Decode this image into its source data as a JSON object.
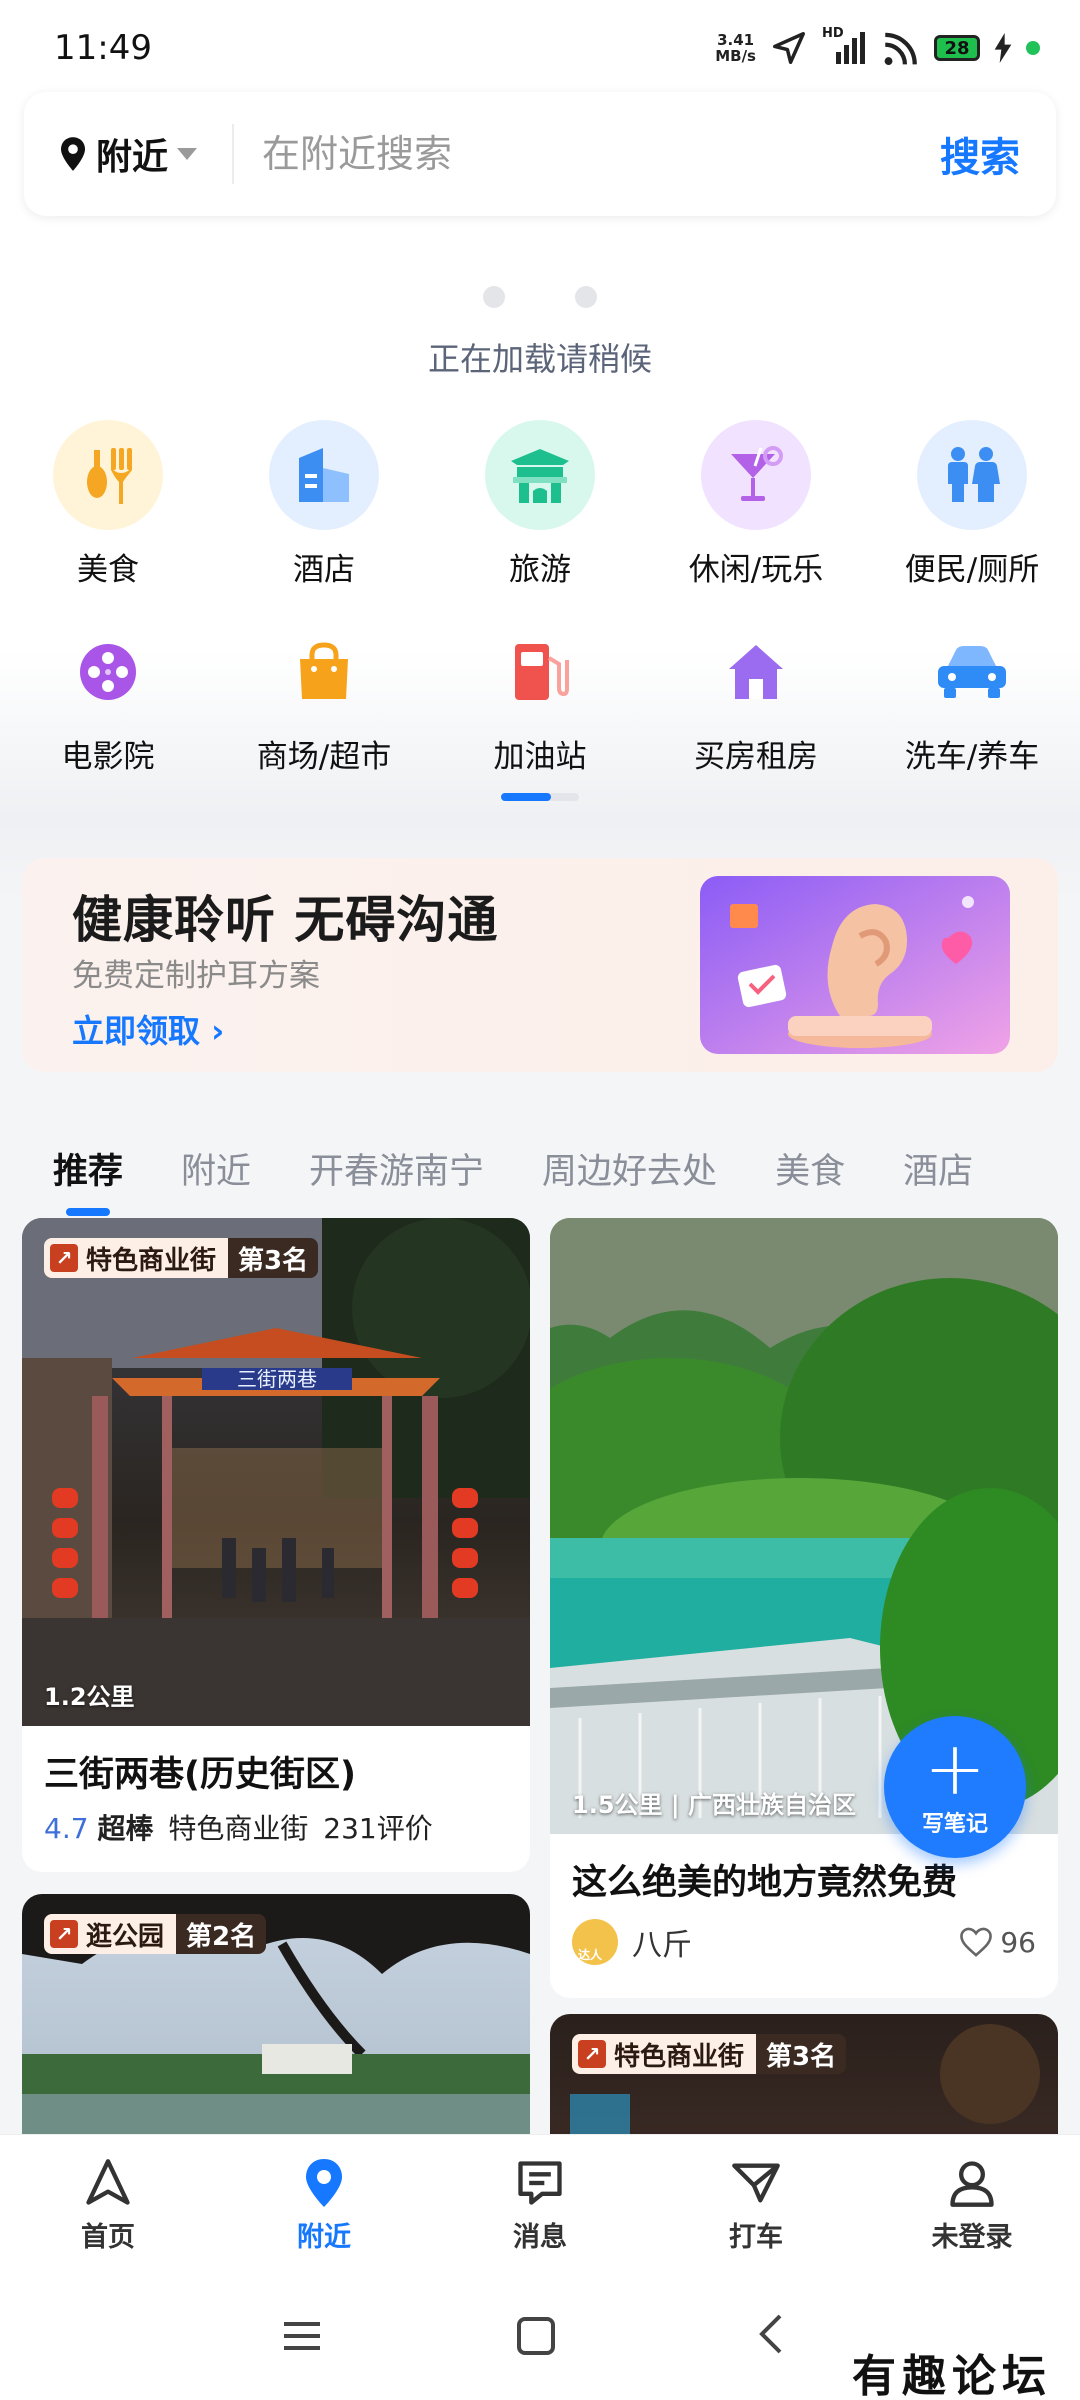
{
  "status_bar": {
    "time": "11:49",
    "net_speed_value": "3.41",
    "net_speed_unit": "MB/s",
    "network": "HD",
    "battery": "28"
  },
  "search": {
    "location_label": "附近",
    "placeholder": "在附近搜索",
    "button_label": "搜索"
  },
  "loading": {
    "text": "正在加载请稍候"
  },
  "categories": [
    {
      "label": "美食",
      "icon": "fork-spoon-icon",
      "color": "#f5a623"
    },
    {
      "label": "酒店",
      "icon": "hotel-building-icon",
      "color": "#3c8ef3"
    },
    {
      "label": "旅游",
      "icon": "pavilion-icon",
      "color": "#1dbf8e"
    },
    {
      "label": "休闲/玩乐",
      "icon": "cocktail-icon",
      "color": "#b361e6"
    },
    {
      "label": "便民/厕所",
      "icon": "restroom-icon",
      "color": "#3c8ef3"
    },
    {
      "label": "电影院",
      "icon": "film-reel-icon",
      "color": "#a855e8"
    },
    {
      "label": "商场/超市",
      "icon": "shopping-bag-icon",
      "color": "#f7a21b"
    },
    {
      "label": "加油站",
      "icon": "gas-pump-icon",
      "color": "#f0524d"
    },
    {
      "label": "买房租房",
      "icon": "house-icon",
      "color": "#9b6cf0"
    },
    {
      "label": "洗车/养车",
      "icon": "car-icon",
      "color": "#2f8cf6"
    }
  ],
  "banner": {
    "title": "健康聆听 无碍沟通",
    "subtitle": "免费定制护耳方案",
    "cta": "立即领取"
  },
  "tabs": [
    "推荐",
    "附近",
    "开春游南宁",
    "周边好去处",
    "美食",
    "酒店"
  ],
  "feed": {
    "card1": {
      "badge_kind": "特色商业街",
      "badge_rank": "第3名",
      "distance": "1.2公里",
      "sign_text": "三街两巷",
      "title": "三街两巷(历史街区)",
      "score": "4.7",
      "rating_word": "超棒",
      "category": "特色商业街",
      "reviews": "231评价"
    },
    "card2": {
      "distance": "1.5公里",
      "region": "广西壮族自治区",
      "title": "这么绝美的地方竟然免费",
      "author": "八斤",
      "author_tag": "达人",
      "likes": "96"
    },
    "card3": {
      "badge_kind": "逛公园",
      "badge_rank": "第2名"
    },
    "card4": {
      "badge_kind": "特色商业街",
      "badge_rank": "第3名"
    }
  },
  "fab": {
    "label": "写笔记"
  },
  "bottom_nav": [
    {
      "label": "首页",
      "icon": "home-triangle-icon"
    },
    {
      "label": "附近",
      "icon": "location-pin-icon"
    },
    {
      "label": "消息",
      "icon": "message-icon"
    },
    {
      "label": "打车",
      "icon": "taxi-icon"
    },
    {
      "label": "未登录",
      "icon": "user-icon"
    }
  ],
  "watermark": "有趣论坛"
}
